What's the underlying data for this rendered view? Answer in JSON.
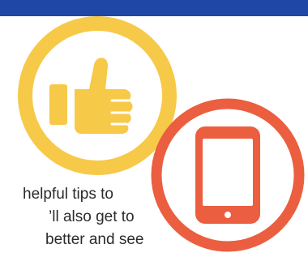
{
  "colors": {
    "top_bar": "#1E47A6",
    "thumbs_circle": "#F7C948",
    "phone_circle": "#EB5E40",
    "background": "#FFFFFF",
    "text": "#2B2B2B"
  },
  "icons": {
    "thumbs": "thumbs-up-icon",
    "phone": "smartphone-icon"
  },
  "text_lines": [
    "helpful tips to",
    "’ll also get to",
    "better and see"
  ]
}
